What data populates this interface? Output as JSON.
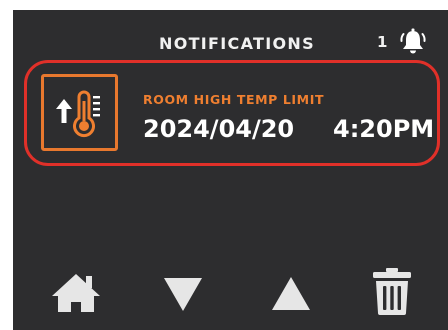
{
  "header": {
    "title": "NOTIFICATIONS",
    "count": "1",
    "icon": "bell-icon"
  },
  "notification": {
    "title": "ROOM HIGH TEMP LIMIT",
    "date": "2024/04/20",
    "time": "4:20PM",
    "icon": "thermometer-rising-icon"
  },
  "nav": {
    "home": "home-icon",
    "down": "arrow-down-icon",
    "up": "arrow-up-icon",
    "delete": "trash-icon"
  },
  "colors": {
    "background": "#2d2d2f",
    "text": "#f1f1f1",
    "alert_border": "#e03029",
    "alert_accent": "#ef7f30",
    "icon_gray": "#e6e6e6"
  }
}
